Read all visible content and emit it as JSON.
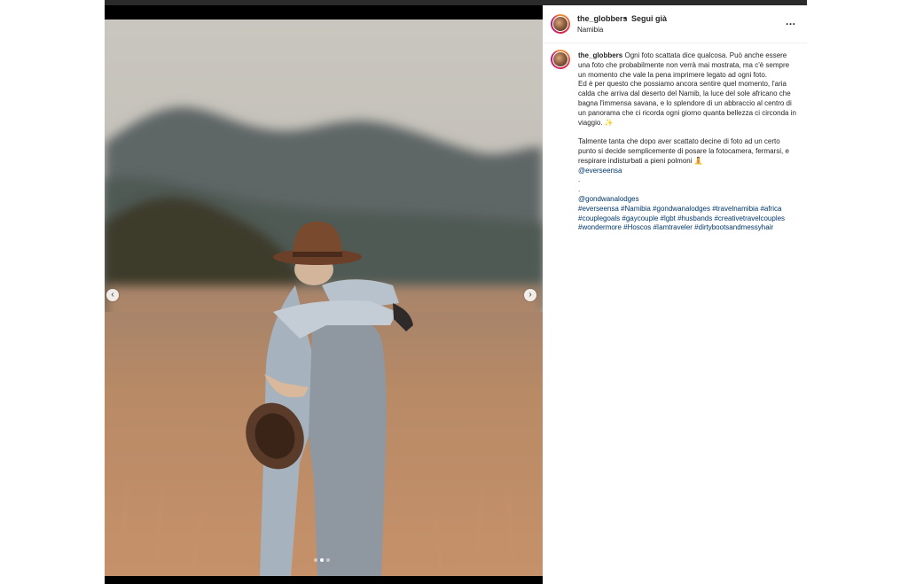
{
  "post": {
    "username": "the_globbers",
    "separator": "•",
    "follow_label": "Segui già",
    "location": "Namibia",
    "more_label": "...",
    "carousel": {
      "total": 3,
      "current": 2,
      "prev_label": "‹",
      "next_label": "›"
    }
  },
  "caption": {
    "username": "the_globbers",
    "para1": "Ogni foto scattata dice qualcosa. Può anche essere una foto che probabilmente non verrà mai mostrata, ma c'è sempre un momento che vale la pena imprimere legato ad ogni foto.",
    "para2": "Ed è per questo che possiamo ancora sentire quel momento, l'aria calda che arriva dal deserto del Namib, la luce del sole africano che bagna l'immensa savana, e lo splendore di un abbraccio al centro di un panorama che ci ricorda ogni giorno quanta bellezza ci circonda in viaggio. ✨",
    "para3": "Talmente tanta che dopo aver scattato decine di foto ad un certo punto si decide semplicemente di posare la fotocamera, fermarsi, e respirare indisturbati a pieni polmoni 🧘",
    "mention1": "@everseensa",
    "dot1": ".",
    "dot2": ".",
    "mention2": "@gondwanalodges",
    "hashtags": "#everseensa #Namibia #gondwanalodges #travelnamibia #africa #couplegoals #gaycouple #lgbt #husbands #creativetravelcouples #wondermore #Hoscos #Iamtraveler #dirtybootsandmessyhair"
  },
  "colors": {
    "link": "#00376b",
    "text": "#262626",
    "divider": "#efefef"
  }
}
